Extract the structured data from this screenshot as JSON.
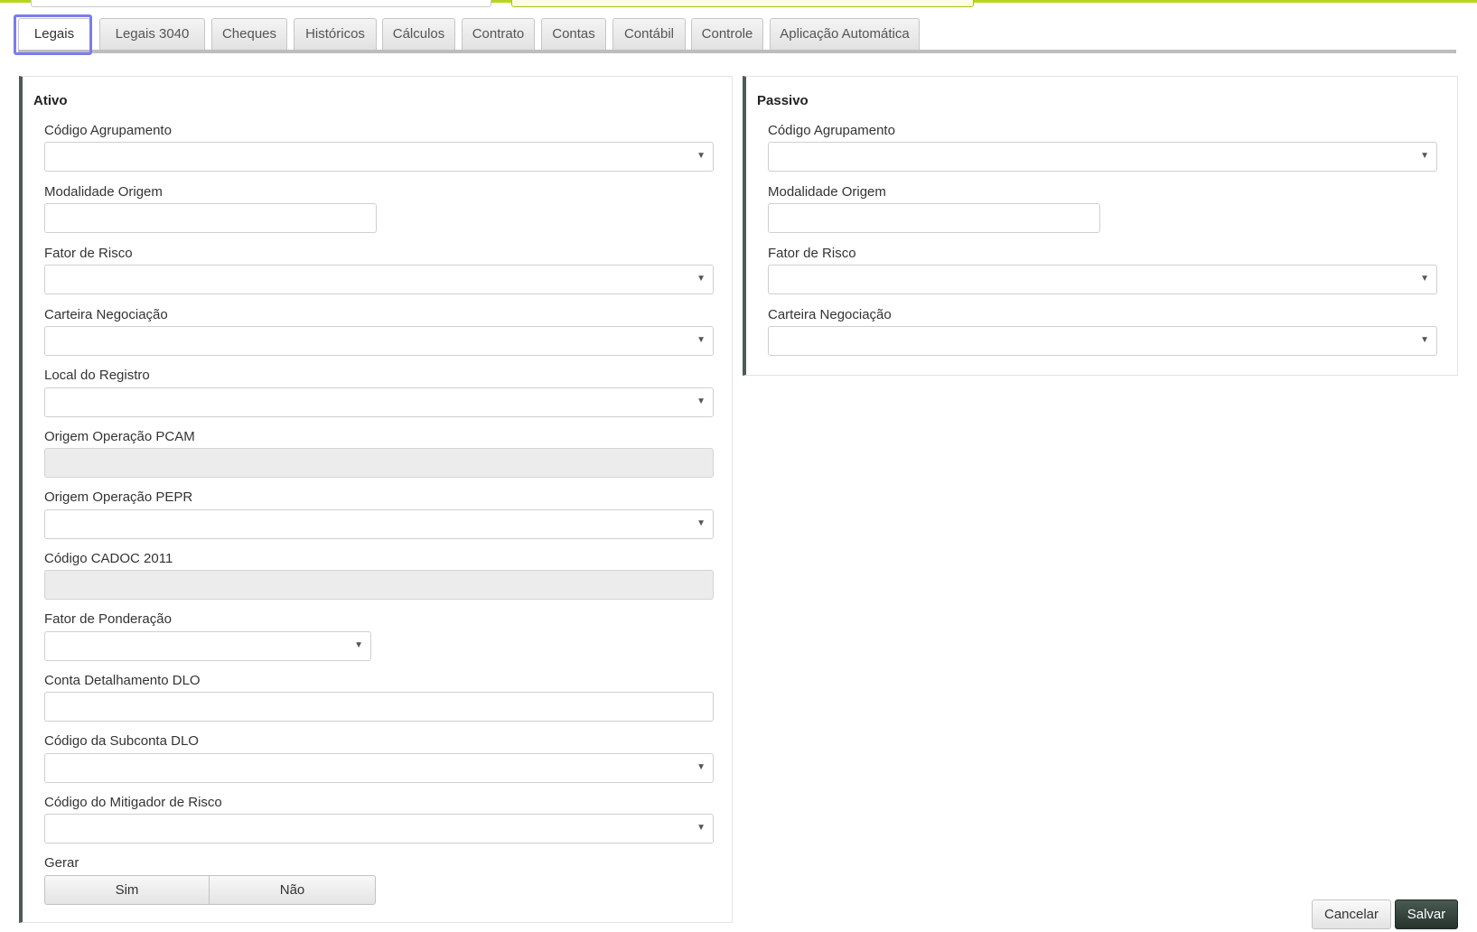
{
  "colors": {
    "accent": "#b6d61d",
    "panel_border": "#4d5b55",
    "save_button": "#2c3a33",
    "focus_outline": "#7b7bf0"
  },
  "tabs": [
    {
      "label": "Legais",
      "active": true
    },
    {
      "label": "Legais 3040"
    },
    {
      "label": "Cheques"
    },
    {
      "label": "Históricos"
    },
    {
      "label": "Cálculos"
    },
    {
      "label": "Contrato"
    },
    {
      "label": "Contas"
    },
    {
      "label": "Contábil"
    },
    {
      "label": "Controle"
    },
    {
      "label": "Aplicação Automática"
    }
  ],
  "ativo": {
    "title": "Ativo",
    "fields": [
      {
        "label": "Código Agrupamento",
        "type": "select",
        "value": ""
      },
      {
        "label": "Modalidade Origem",
        "type": "text",
        "value": ""
      },
      {
        "label": "Fator de Risco",
        "type": "select",
        "value": ""
      },
      {
        "label": "Carteira Negociação",
        "type": "select",
        "value": ""
      },
      {
        "label": "Local do Registro",
        "type": "select",
        "value": ""
      },
      {
        "label": "Origem Operação PCAM",
        "type": "disabled",
        "value": ""
      },
      {
        "label": "Origem Operação PEPR",
        "type": "select",
        "value": ""
      },
      {
        "label": "Código CADOC 2011",
        "type": "disabled",
        "value": ""
      },
      {
        "label": "Fator de Ponderação",
        "type": "select",
        "value": ""
      },
      {
        "label": "Conta Detalhamento DLO",
        "type": "text",
        "value": ""
      },
      {
        "label": "Código da Subconta DLO",
        "type": "select",
        "value": ""
      },
      {
        "label": "Código do Mitigador de Risco",
        "type": "select",
        "value": ""
      }
    ],
    "gerar": {
      "label": "Gerar",
      "options": [
        "Sim",
        "Não"
      ]
    }
  },
  "passivo": {
    "title": "Passivo",
    "fields": [
      {
        "label": "Código Agrupamento",
        "type": "select",
        "value": ""
      },
      {
        "label": "Modalidade Origem",
        "type": "text",
        "value": ""
      },
      {
        "label": "Fator de Risco",
        "type": "select",
        "value": ""
      },
      {
        "label": "Carteira Negociação",
        "type": "select",
        "value": ""
      }
    ]
  },
  "actions": {
    "cancel_label": "Cancelar",
    "save_label": "Salvar"
  },
  "icons": {
    "dropdown": "caret-down-icon"
  }
}
